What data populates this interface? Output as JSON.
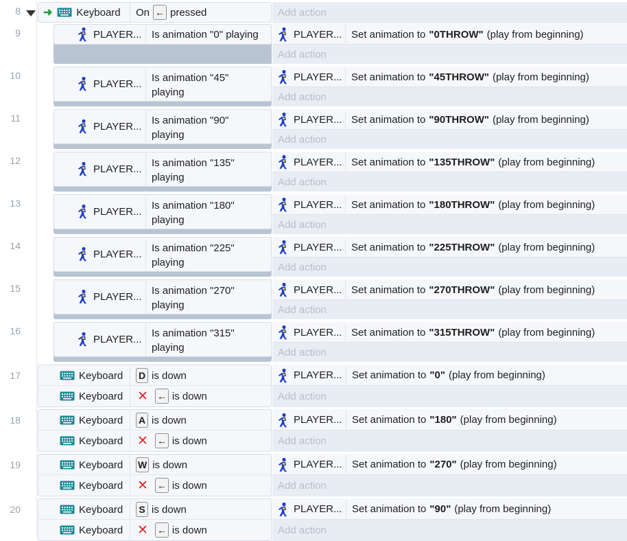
{
  "row8": {
    "num": "8",
    "object": "Keyboard",
    "cond_prefix": "On",
    "key": "←",
    "cond_suffix": "pressed",
    "add_action": "Add action"
  },
  "subevents": [
    {
      "num": "9",
      "object": "PLAYER...",
      "cond_line1": "Is animation \"0\" playing",
      "cond_line2": "",
      "act_object": "PLAYER...",
      "act_prefix": "Set animation to",
      "act_value": "\"0THROW\"",
      "act_suffix": "(play from beginning)",
      "add_action": "Add action"
    },
    {
      "num": "10",
      "object": "PLAYER...",
      "cond_line1": "Is animation \"45\"",
      "cond_line2": "playing",
      "act_object": "PLAYER...",
      "act_prefix": "Set animation to",
      "act_value": "\"45THROW\"",
      "act_suffix": "(play from beginning)",
      "add_action": "Add action"
    },
    {
      "num": "11",
      "object": "PLAYER...",
      "cond_line1": "Is animation \"90\"",
      "cond_line2": "playing",
      "act_object": "PLAYER...",
      "act_prefix": "Set animation to",
      "act_value": "\"90THROW\"",
      "act_suffix": "(play from beginning)",
      "add_action": "Add action"
    },
    {
      "num": "12",
      "object": "PLAYER...",
      "cond_line1": "Is animation \"135\"",
      "cond_line2": "playing",
      "act_object": "PLAYER...",
      "act_prefix": "Set animation to",
      "act_value": "\"135THROW\"",
      "act_suffix": "(play from beginning)",
      "add_action": "Add action"
    },
    {
      "num": "13",
      "object": "PLAYER...",
      "cond_line1": "Is animation \"180\"",
      "cond_line2": "playing",
      "act_object": "PLAYER...",
      "act_prefix": "Set animation to",
      "act_value": "\"180THROW\"",
      "act_suffix": "(play from beginning)",
      "add_action": "Add action"
    },
    {
      "num": "14",
      "object": "PLAYER...",
      "cond_line1": "Is animation \"225\"",
      "cond_line2": "playing",
      "act_object": "PLAYER...",
      "act_prefix": "Set animation to",
      "act_value": "\"225THROW\"",
      "act_suffix": "(play from beginning)",
      "add_action": "Add action"
    },
    {
      "num": "15",
      "object": "PLAYER...",
      "cond_line1": "Is animation \"270\"",
      "cond_line2": "playing",
      "act_object": "PLAYER...",
      "act_prefix": "Set animation to",
      "act_value": "\"270THROW\"",
      "act_suffix": "(play from beginning)",
      "add_action": "Add action"
    },
    {
      "num": "16",
      "object": "PLAYER...",
      "cond_line1": "Is animation \"315\"",
      "cond_line2": "playing",
      "act_object": "PLAYER...",
      "act_prefix": "Set animation to",
      "act_value": "\"315THROW\"",
      "act_suffix": "(play from beginning)",
      "add_action": "Add action"
    }
  ],
  "keyevents": [
    {
      "num": "17",
      "object": "Keyboard",
      "key": "D",
      "key_suffix": "is down",
      "object2": "Keyboard",
      "key2": "←",
      "key2_suffix": "is down",
      "act_object": "PLAYER...",
      "act_prefix": "Set animation to",
      "act_value": "\"0\"",
      "act_suffix": "(play from beginning)",
      "add_action": "Add action"
    },
    {
      "num": "18",
      "object": "Keyboard",
      "key": "A",
      "key_suffix": "is down",
      "object2": "Keyboard",
      "key2": "←",
      "key2_suffix": "is down",
      "act_object": "PLAYER...",
      "act_prefix": "Set animation to",
      "act_value": "\"180\"",
      "act_suffix": "(play from beginning)",
      "add_action": "Add action"
    },
    {
      "num": "19",
      "object": "Keyboard",
      "key": "W",
      "key_suffix": "is down",
      "object2": "Keyboard",
      "key2": "←",
      "key2_suffix": "is down",
      "act_object": "PLAYER...",
      "act_prefix": "Set animation to",
      "act_value": "\"270\"",
      "act_suffix": "(play from beginning)",
      "add_action": "Add action"
    },
    {
      "num": "20",
      "object": "Keyboard",
      "key": "S",
      "key_suffix": "is down",
      "object2": "Keyboard",
      "key2": "←",
      "key2_suffix": "is down",
      "act_object": "PLAYER...",
      "act_prefix": "Set animation to",
      "act_value": "\"90\"",
      "act_suffix": "(play from beginning)",
      "add_action": "Add action"
    }
  ],
  "colors": {
    "keyboard_icon": "#1b8a94",
    "player_icon": "#1f3fbf",
    "invert_x": "#e02828",
    "trigger_arrow": "#1f9d3a"
  }
}
